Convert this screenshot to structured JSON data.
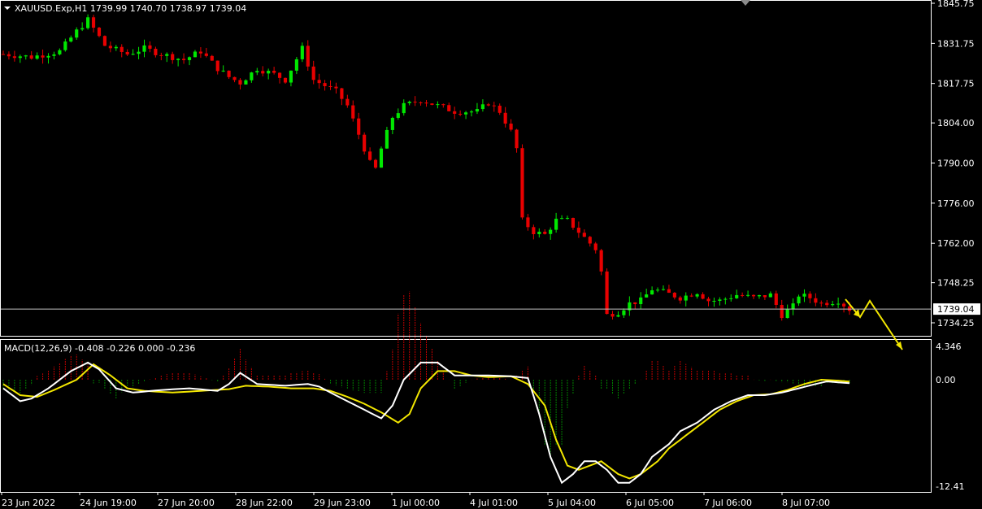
{
  "header": {
    "symbol_info": "XAUUSD.Exp,H1  1739.99 1740.70 1738.97 1739.04"
  },
  "macd_header": {
    "text": "MACD(12,26,9) -0.408 -0.226 0.000 -0.236"
  },
  "colors": {
    "background": "#000000",
    "bull_candle": "#00e800",
    "bear_candle": "#e80000",
    "axis_text": "#ffffff",
    "frame": "#ffffff",
    "macd_line": "#ffffff",
    "signal_line": "#f2e600",
    "hist_pos": "#c00000",
    "hist_neg": "#008000",
    "arrow": "#f2e600",
    "price_line": "#c0c0c0"
  },
  "price_axis": {
    "ticks": [
      "1845.75",
      "1831.75",
      "1817.75",
      "1804.00",
      "1790.00",
      "1776.00",
      "1762.00",
      "1748.25",
      "1734.25"
    ],
    "current_price": "1739.04"
  },
  "macd_axis": {
    "ticks": [
      "4.346",
      "0.00",
      "-12.41"
    ]
  },
  "time_axis": {
    "labels": [
      "23 Jun 2022",
      "24 Jun 19:00",
      "27 Jun 20:00",
      "28 Jun 22:00",
      "29 Jun 23:00",
      "1 Jul 00:00",
      "4 Jul 01:00",
      "5 Jul 04:00",
      "6 Jul 05:00",
      "7 Jul 06:00",
      "8 Jul 07:00"
    ]
  },
  "chart_data": {
    "type": "candlestick",
    "title": "XAUUSD.Exp,H1",
    "ohlc": [
      1739.99,
      1740.7,
      1738.97,
      1739.04
    ],
    "ylim": [
      1727,
      1848
    ],
    "price_path": [
      [
        0,
        1828
      ],
      [
        5,
        1827
      ],
      [
        10,
        1829
      ],
      [
        13,
        1836
      ],
      [
        15,
        1840
      ],
      [
        18,
        1831
      ],
      [
        22,
        1828
      ],
      [
        25,
        1830
      ],
      [
        28,
        1828
      ],
      [
        32,
        1826
      ],
      [
        35,
        1829
      ],
      [
        38,
        1823
      ],
      [
        40,
        1820
      ],
      [
        42,
        1818
      ],
      [
        45,
        1823
      ],
      [
        48,
        1821
      ],
      [
        50,
        1819
      ],
      [
        53,
        1830
      ],
      [
        55,
        1819
      ],
      [
        57,
        1817
      ],
      [
        59,
        1815
      ],
      [
        61,
        1810
      ],
      [
        62,
        1805
      ],
      [
        63,
        1800
      ],
      [
        64,
        1795
      ],
      [
        65,
        1790
      ],
      [
        66,
        1788
      ],
      [
        67,
        1795
      ],
      [
        69,
        1806
      ],
      [
        71,
        1810
      ],
      [
        74,
        1812
      ],
      [
        77,
        1810
      ],
      [
        80,
        1808
      ],
      [
        84,
        1808
      ],
      [
        86,
        1811
      ],
      [
        88,
        1808
      ],
      [
        90,
        1801
      ],
      [
        91,
        1795
      ],
      [
        92,
        1770
      ],
      [
        94,
        1766
      ],
      [
        96,
        1765
      ],
      [
        98,
        1770
      ],
      [
        100,
        1770
      ],
      [
        103,
        1764
      ],
      [
        105,
        1760
      ],
      [
        106,
        1752
      ],
      [
        107,
        1737
      ],
      [
        109,
        1738
      ],
      [
        111,
        1741
      ],
      [
        113,
        1742
      ],
      [
        115,
        1746
      ],
      [
        117,
        1745
      ],
      [
        120,
        1743
      ],
      [
        123,
        1745
      ],
      [
        125,
        1742
      ],
      [
        127,
        1742
      ],
      [
        130,
        1744
      ],
      [
        133,
        1743
      ],
      [
        136,
        1744
      ],
      [
        138,
        1737
      ],
      [
        140,
        1740
      ],
      [
        141,
        1744
      ],
      [
        143,
        1743
      ],
      [
        145,
        1741
      ],
      [
        148,
        1742
      ],
      [
        150,
        1739
      ]
    ],
    "macd": [
      [
        0,
        -1.0
      ],
      [
        3,
        -2.5
      ],
      [
        5,
        -2.2
      ],
      [
        8,
        -1.0
      ],
      [
        12,
        1.0
      ],
      [
        15,
        2.0
      ],
      [
        17,
        1.2
      ],
      [
        20,
        -1.0
      ],
      [
        23,
        -1.5
      ],
      [
        28,
        -1.2
      ],
      [
        33,
        -1.0
      ],
      [
        38,
        -1.3
      ],
      [
        40,
        -0.5
      ],
      [
        42,
        0.8
      ],
      [
        45,
        -0.5
      ],
      [
        50,
        -0.7
      ],
      [
        54,
        -0.5
      ],
      [
        56,
        -0.8
      ],
      [
        58,
        -1.5
      ],
      [
        61,
        -2.5
      ],
      [
        64,
        -3.5
      ],
      [
        67,
        -4.5
      ],
      [
        69,
        -3.0
      ],
      [
        71,
        0.0
      ],
      [
        74,
        2.0
      ],
      [
        77,
        2.0
      ],
      [
        80,
        0.5
      ],
      [
        83,
        0.5
      ],
      [
        86,
        0.5
      ],
      [
        90,
        0.4
      ],
      [
        93,
        0.2
      ],
      [
        95,
        -4.0
      ],
      [
        97,
        -9.0
      ],
      [
        99,
        -12.0
      ],
      [
        101,
        -11.0
      ],
      [
        103,
        -9.5
      ],
      [
        105,
        -9.5
      ],
      [
        107,
        -10.5
      ],
      [
        109,
        -12.0
      ],
      [
        111,
        -12.0
      ],
      [
        113,
        -11.0
      ],
      [
        115,
        -9.0
      ],
      [
        118,
        -7.5
      ],
      [
        120,
        -6.0
      ],
      [
        123,
        -5.0
      ],
      [
        126,
        -3.5
      ],
      [
        129,
        -2.5
      ],
      [
        132,
        -1.8
      ],
      [
        135,
        -1.8
      ],
      [
        138,
        -1.5
      ],
      [
        141,
        -1.0
      ],
      [
        144,
        -0.5
      ],
      [
        146,
        -0.2
      ],
      [
        148,
        -0.3
      ],
      [
        150,
        -0.408
      ]
    ],
    "signal": [
      [
        0,
        -0.5
      ],
      [
        3,
        -1.8
      ],
      [
        6,
        -2.0
      ],
      [
        9,
        -1.2
      ],
      [
        13,
        0.0
      ],
      [
        16,
        1.8
      ],
      [
        19,
        0.5
      ],
      [
        22,
        -1.0
      ],
      [
        25,
        -1.3
      ],
      [
        30,
        -1.5
      ],
      [
        35,
        -1.3
      ],
      [
        40,
        -1.1
      ],
      [
        43,
        -0.7
      ],
      [
        47,
        -0.8
      ],
      [
        51,
        -1.0
      ],
      [
        55,
        -1.0
      ],
      [
        58,
        -1.3
      ],
      [
        61,
        -2.0
      ],
      [
        64,
        -2.8
      ],
      [
        67,
        -3.8
      ],
      [
        70,
        -5.0
      ],
      [
        72,
        -4.0
      ],
      [
        74,
        -1.0
      ],
      [
        77,
        1.0
      ],
      [
        80,
        1.0
      ],
      [
        83,
        0.5
      ],
      [
        86,
        0.3
      ],
      [
        90,
        0.4
      ],
      [
        93,
        -0.5
      ],
      [
        96,
        -3.0
      ],
      [
        98,
        -7.0
      ],
      [
        100,
        -10.0
      ],
      [
        102,
        -10.5
      ],
      [
        104,
        -10.0
      ],
      [
        106,
        -9.5
      ],
      [
        109,
        -11.0
      ],
      [
        111,
        -11.5
      ],
      [
        113,
        -11.0
      ],
      [
        116,
        -9.5
      ],
      [
        118,
        -8.0
      ],
      [
        121,
        -6.5
      ],
      [
        124,
        -5.0
      ],
      [
        127,
        -3.5
      ],
      [
        130,
        -2.5
      ],
      [
        133,
        -1.8
      ],
      [
        136,
        -1.7
      ],
      [
        139,
        -1.2
      ],
      [
        142,
        -0.5
      ],
      [
        145,
        0.0
      ],
      [
        148,
        -0.1
      ],
      [
        150,
        -0.226
      ]
    ],
    "macd_ylim": [
      -13,
      6.0
    ],
    "arrow_path": [
      [
        1736,
        1732
      ],
      [
        1732,
        1737
      ],
      [
        1737,
        1713
      ]
    ]
  }
}
